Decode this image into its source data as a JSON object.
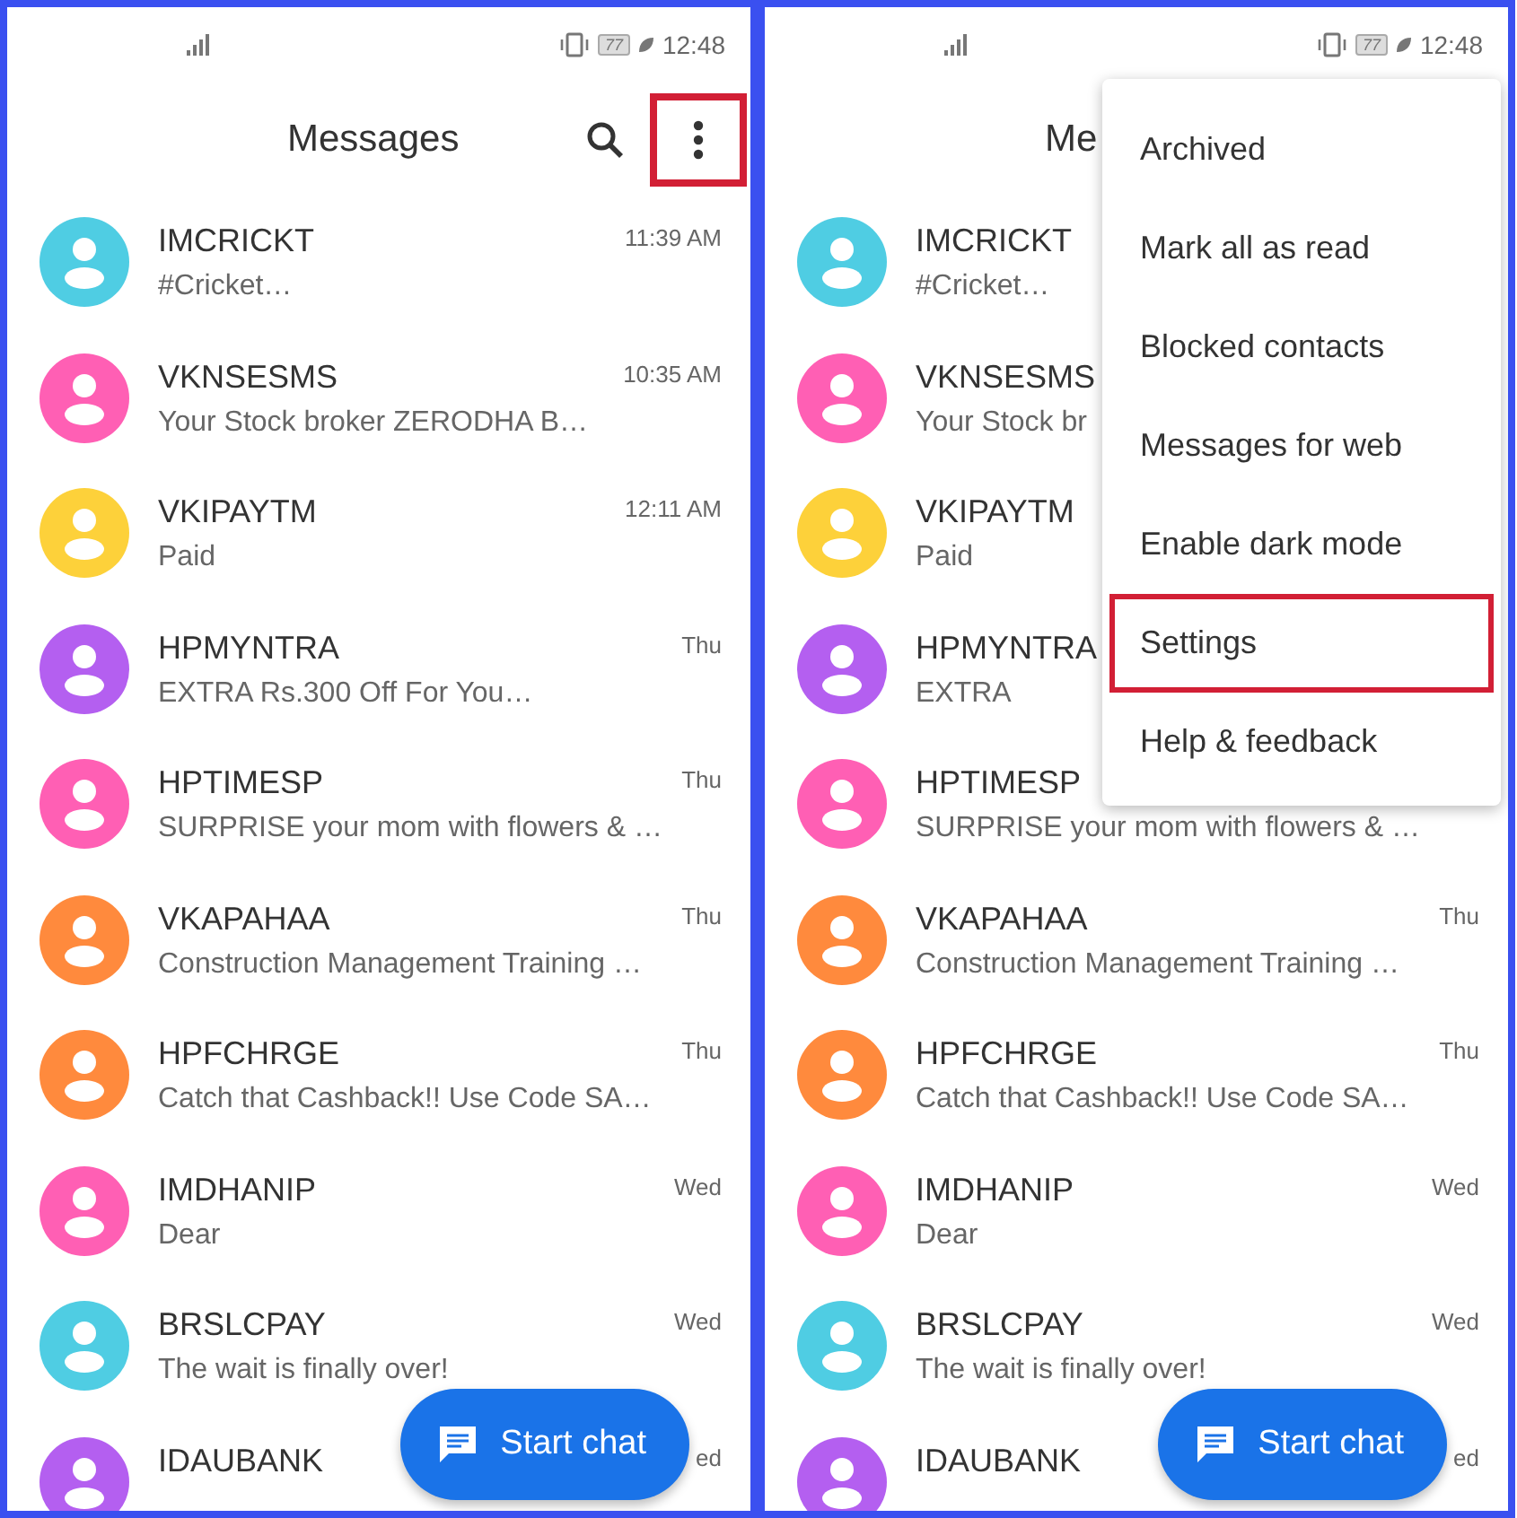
{
  "screens": [
    {
      "status_bar": {
        "time": "12:48",
        "battery": "77"
      },
      "title": "Messages",
      "actions_visible": true,
      "overflow_highlighted": true,
      "fab": "Start chat",
      "conversations": [
        {
          "name": "IMCRICKT",
          "preview": "#Cricket…",
          "time": "11:39 AM",
          "color": "#4fcde3"
        },
        {
          "name": "VKNSESMS",
          "preview": "Your Stock broker ZERODHA B…",
          "time": "10:35 AM",
          "color": "#ff5fb4"
        },
        {
          "name": "VKIPAYTM",
          "preview": "Paid",
          "time": "12:11 AM",
          "color": "#fdd13a"
        },
        {
          "name": "HPMYNTRA",
          "preview": "EXTRA Rs.300 Off For You…",
          "time": "Thu",
          "color": "#b45ff0"
        },
        {
          "name": "HPTIMESP",
          "preview": "SURPRISE your mom with flowers & …",
          "time": "Thu",
          "color": "#ff5fb4"
        },
        {
          "name": "VKAPAHAA",
          "preview": "Construction Management Training …",
          "time": "Thu",
          "color": "#ff8a3d"
        },
        {
          "name": "HPFCHRGE",
          "preview": "Catch that Cashback!! Use Code SA…",
          "time": "Thu",
          "color": "#ff8a3d"
        },
        {
          "name": "IMDHANIP",
          "preview": "Dear",
          "time": "Wed",
          "color": "#ff5fb4"
        },
        {
          "name": "BRSLCPAY",
          "preview": "The wait is finally over!",
          "time": "Wed",
          "color": "#4fcde3"
        },
        {
          "name": "IDAUBANK",
          "time": "ed",
          "color": "#b45ff0"
        }
      ]
    },
    {
      "status_bar": {
        "time": "12:48",
        "battery": "77"
      },
      "title": "Me",
      "actions_visible": false,
      "fab": "Start chat",
      "conversations": [
        {
          "name": "IMCRICKT",
          "preview": "#Cricket…",
          "color": "#4fcde3"
        },
        {
          "name": "VKNSESMS",
          "preview": "Your Stock br",
          "color": "#ff5fb4"
        },
        {
          "name": "VKIPAYTM",
          "preview": "Paid",
          "color": "#fdd13a"
        },
        {
          "name": "HPMYNTRA",
          "preview": "EXTRA",
          "color": "#b45ff0"
        },
        {
          "name": "HPTIMESP",
          "preview": "SURPRISE your mom with flowers & …",
          "color": "#ff5fb4"
        },
        {
          "name": "VKAPAHAA",
          "preview": "Construction Management Training …",
          "time": "Thu",
          "color": "#ff8a3d"
        },
        {
          "name": "HPFCHRGE",
          "preview": "Catch that Cashback!! Use Code SA…",
          "time": "Thu",
          "color": "#ff8a3d"
        },
        {
          "name": "IMDHANIP",
          "preview": "Dear",
          "time": "Wed",
          "color": "#ff5fb4"
        },
        {
          "name": "BRSLCPAY",
          "preview": "The wait is finally over!",
          "time": "Wed",
          "color": "#4fcde3"
        },
        {
          "name": "IDAUBANK",
          "time": "ed",
          "color": "#b45ff0"
        }
      ],
      "menu": [
        {
          "label": "Archived",
          "highlighted": false
        },
        {
          "label": "Mark all as read",
          "highlighted": false
        },
        {
          "label": "Blocked contacts",
          "highlighted": false
        },
        {
          "label": "Messages for web",
          "highlighted": false
        },
        {
          "label": "Enable dark mode",
          "highlighted": false
        },
        {
          "label": "Settings",
          "highlighted": true
        },
        {
          "label": "Help & feedback",
          "highlighted": false
        }
      ]
    }
  ]
}
